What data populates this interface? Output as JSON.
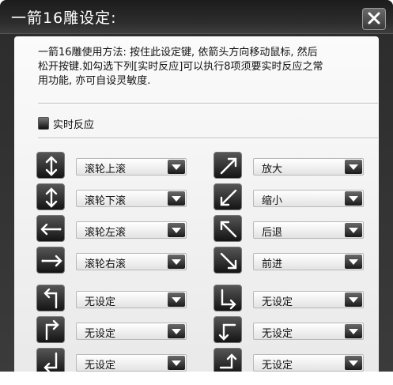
{
  "window": {
    "title": "一箭16雕设定:"
  },
  "description": {
    "line1": "一箭16雕使用方法: 按住此设定键, 依箭头方向移动鼠标, 然后",
    "line2": "松开按键.如勾选下列[实时反应]可以执行8项须要实时反应之常",
    "line3": "用功能, 亦可自设灵敏度."
  },
  "realtime_checkbox": {
    "label": "实时反应",
    "checked": false
  },
  "mappings": {
    "left": [
      {
        "icon": "arrow-up-down-icon",
        "value": "滚轮上滚"
      },
      {
        "icon": "arrow-down-up-icon",
        "value": "滚轮下滚"
      },
      {
        "icon": "arrow-right-left-icon",
        "value": "滚轮左滚"
      },
      {
        "icon": "arrow-left-right-icon",
        "value": "滚轮右滚"
      },
      {
        "icon": "arrow-up-left-hook-icon",
        "value": "无设定"
      },
      {
        "icon": "arrow-up-right-hook-icon",
        "value": "无设定"
      },
      {
        "icon": "arrow-down-left-hook-icon",
        "value": "无设定"
      }
    ],
    "right": [
      {
        "icon": "arrow-diagonal-up-right-icon",
        "value": "放大"
      },
      {
        "icon": "arrow-diagonal-down-left-icon",
        "value": "缩小"
      },
      {
        "icon": "arrow-diagonal-up-left-icon",
        "value": "后退"
      },
      {
        "icon": "arrow-diagonal-down-right-icon",
        "value": "前进"
      },
      {
        "icon": "arrow-right-down-hook-icon",
        "value": "无设定"
      },
      {
        "icon": "arrow-left-down-hook-icon",
        "value": "无设定"
      },
      {
        "icon": "arrow-up-hook-icon",
        "value": "无设定"
      }
    ]
  }
}
